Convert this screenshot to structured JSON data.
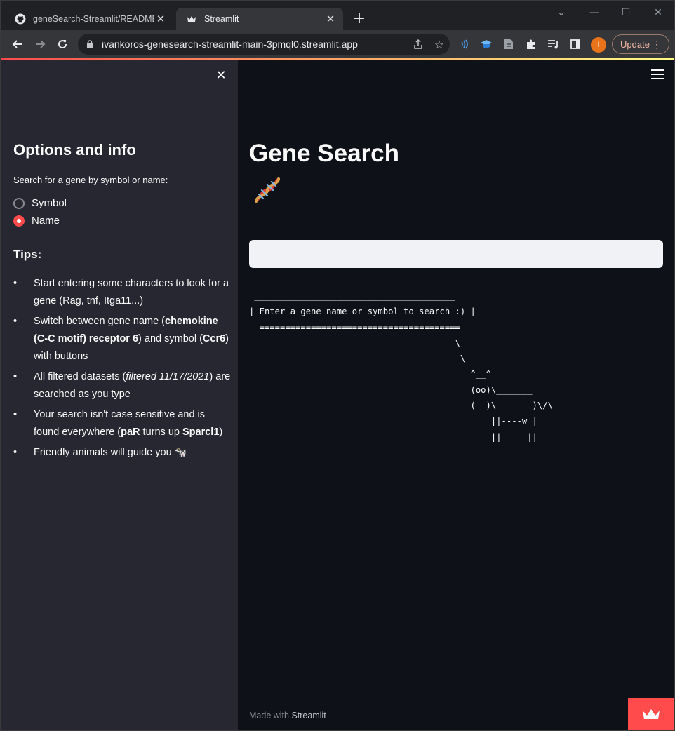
{
  "browser": {
    "tabs": [
      {
        "title": "geneSearch-Streamlit/README.m",
        "icon": "github-icon",
        "active": false
      },
      {
        "title": "Streamlit",
        "icon": "streamlit-crown-icon",
        "active": true
      }
    ],
    "url": "ivankoros-genesearch-streamlit-main-3pmql0.streamlit.app",
    "profile_initial": "I",
    "update_label": "Update",
    "colors": {
      "accent": "#ff4b4b",
      "profile": "#e8731a"
    }
  },
  "sidebar": {
    "title": "Options and info",
    "search_label": "Search for a gene by symbol or name:",
    "options": [
      {
        "label": "Symbol",
        "selected": false
      },
      {
        "label": "Name",
        "selected": true
      }
    ],
    "tips_title": "Tips:",
    "tips": [
      {
        "text_a": "Start entering some characters to look for a gene (Rag, tnf, Itga11...)"
      },
      {
        "text_a": "Switch between gene name (",
        "bold_a": "chemokine (C-C motif) receptor 6",
        "text_b": ") and symbol (",
        "bold_b": "Ccr6",
        "text_c": ") with buttons"
      },
      {
        "text_a": "All filtered datasets (",
        "italic_a": "filtered 11/17/2021",
        "text_b": ") are searched as you type"
      },
      {
        "text_a": "Your search isn't case sensitive and is found everywhere (",
        "bold_a": "paR",
        "text_b": " turns up ",
        "bold_b": "Sparcl1",
        "text_c": ")"
      },
      {
        "text_a": "Friendly animals will guide you ",
        "emoji": "🐄"
      }
    ]
  },
  "main": {
    "title": "Gene Search",
    "title_emoji": "dna-icon",
    "search_value": "",
    "ascii_art": " _______________________________________\n| Enter a gene name or symbol to search :) |\n  =======================================\n                                        \\\n                                         \\\n                                           ^__^\n                                           (oo)\\_______\n                                           (__)\\       )\\/\\\n                                               ||----w |\n                                               ||     ||",
    "footer_prefix": "Made with ",
    "footer_brand": "Streamlit"
  }
}
